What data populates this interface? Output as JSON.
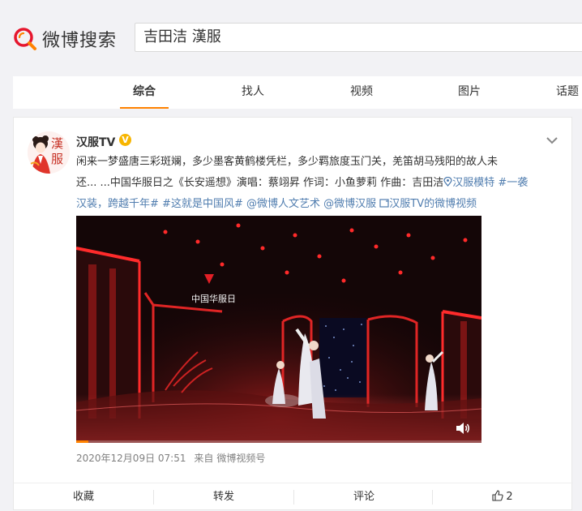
{
  "header": {
    "logo_text": "微博搜索",
    "search_query": "吉田洁 漢服"
  },
  "tabs": [
    {
      "label": "综合",
      "active": true
    },
    {
      "label": "找人"
    },
    {
      "label": "视频"
    },
    {
      "label": "图片"
    },
    {
      "label": "话题"
    }
  ],
  "post": {
    "avatar_text": "漢服",
    "username": "汉服TV",
    "badge": "V",
    "text_line1": "闲来一梦盛唐三彩斑斓，多少墨客黄鹤楼凭栏，多少羁旅度玉门关，羌笛胡马残阳的故人未",
    "text_line2_plain": "还... ...中国华服日之《长安遥想》演唱：蔡翊昇 作词：小鱼萝莉 作曲：吉田洁",
    "link_location": "汉服模特",
    "link_topic1_a": "#一袭",
    "link_topic1_b": "汉装，跨越千年#",
    "link_topic2": "#这就是中国风#",
    "mention1": "@微博人文艺术",
    "mention2": "@微博汉服",
    "video_link": "汉服TV的微博视频",
    "video_logo_text": "中国华服日",
    "video_progress": 0.03,
    "timestamp": "2020年12月09日 07:51",
    "source_prefix": "来自",
    "source": "微博视频号",
    "actions": {
      "collect": "收藏",
      "repost": "转发",
      "comment": "评论",
      "like_count": "2"
    }
  },
  "colors": {
    "accent": "#ff8200",
    "link": "#507daf",
    "badge": "#f7b500"
  },
  "icons": [
    "search-logo-icon",
    "vip-badge-icon",
    "chevron-down-icon",
    "location-icon",
    "video-link-icon",
    "volume-icon",
    "like-icon"
  ]
}
